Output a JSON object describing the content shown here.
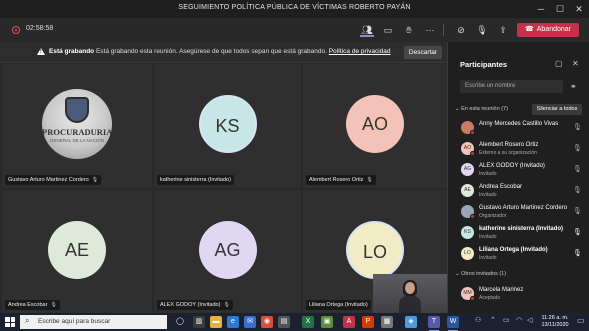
{
  "window": {
    "title": "SEGUIMIENTO POLÍTICA PÚBLICA DE VÍCTIMAS ROBERTO PAYÁN",
    "controls": [
      "minimize-icon",
      "maximize-icon",
      "close-icon"
    ]
  },
  "toolbar": {
    "timer": "02:58:58",
    "leave_label": "Abandonar",
    "icons": [
      "participants-icon",
      "chat-icon",
      "raise-hand-icon",
      "more-icon",
      "camera-off-icon",
      "mic-off-icon",
      "share-tray-icon"
    ]
  },
  "banner": {
    "bold": "Está grabando",
    "message": "Está grabando esta reunión. Asegúrese de que todos sepan que está grabando.",
    "link": "Política de privacidad",
    "dismiss_label": "Descartar"
  },
  "tiles": [
    {
      "name": "Gustavo Arturo Martinez Cordero",
      "initials": "",
      "logo": {
        "text": "PROCURADURIA",
        "subtext": "GENERAL DE LA NACIÓN"
      },
      "color": "#d9d9d9"
    },
    {
      "name": "katherine sinisterra (Invitado)",
      "initials": "KS",
      "color": "#c8e6e5"
    },
    {
      "name": "Alembert Rosero Ortiz",
      "initials": "AO",
      "color": "#f3c3b7"
    },
    {
      "name": "Andrea Escobar",
      "initials": "AE",
      "color": "#dfe9d9"
    },
    {
      "name": "ALEX GODOY (Invitado)",
      "initials": "AG",
      "color": "#e0d7f3"
    },
    {
      "name": "Liliana Ortega (Invitado)",
      "initials": "LO",
      "color": "#f2ecc6"
    }
  ],
  "panel": {
    "title": "Participantes",
    "search_placeholder": "Escribe un nombre",
    "in_meeting_label": "En esta reunión (7)",
    "mute_all_label": "Silenciar a todos",
    "others_label": "Otros invitados (1)",
    "participants": [
      {
        "name": "Anny Mercedes Castillo Vivas",
        "role": "",
        "initials": "",
        "color": "#c87a66",
        "status": "#c4314b",
        "mic": "off"
      },
      {
        "name": "Alembert Rosero Ortiz",
        "role": "Externo a su organización",
        "initials": "AO",
        "color": "#f3c3b7",
        "status": "#c4314b",
        "mic": "off"
      },
      {
        "name": "ALEX GODOY (Invitado)",
        "role": "Invitado",
        "initials": "AG",
        "color": "#e0d7f3",
        "status": "",
        "mic": "off"
      },
      {
        "name": "Andrea Escobar",
        "role": "Invitado",
        "initials": "AE",
        "color": "#dfe9d9",
        "status": "",
        "mic": "off"
      },
      {
        "name": "Gustavo Arturo Martinez Cordero",
        "role": "Organizador",
        "initials": "",
        "color": "#9aa6b8",
        "status": "#c4314b",
        "mic": "off"
      },
      {
        "name": "katherine sinisterra (Invitado)",
        "role": "Invitado",
        "initials": "KS",
        "color": "#c8e6e5",
        "status": "",
        "mic": "on"
      },
      {
        "name": "Liliana Ortega (Invitado)",
        "role": "Invitado",
        "initials": "LO",
        "color": "#f2ecc6",
        "status": "",
        "mic": "on"
      }
    ],
    "others": [
      {
        "name": "Marcela Marinez",
        "role": "Aceptado",
        "initials": "MM",
        "color": "#f3c3b7",
        "status": "#c4314b"
      }
    ]
  },
  "taskbar": {
    "search_placeholder": "Escribe aquí para buscar",
    "time": "11:26 a. m.",
    "date": "13/11/2020"
  }
}
